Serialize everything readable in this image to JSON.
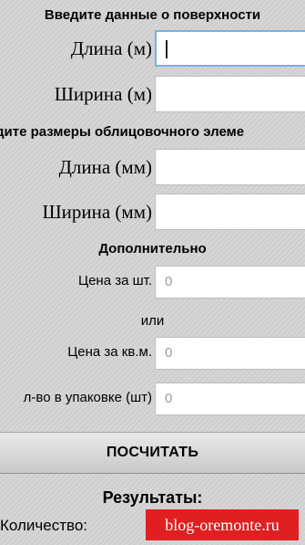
{
  "surface": {
    "heading": "Введите данные о поверхности",
    "length_label": "Длина (м)",
    "width_label": "Ширина (м)"
  },
  "tile": {
    "heading": "дите размеры облицовочного элеме",
    "length_label": "Длина (мм)",
    "width_label": "Ширина (мм)"
  },
  "extra": {
    "heading": "Дополнительно",
    "price_per_piece_label": "Цена за шт.",
    "price_per_piece_placeholder": "0",
    "or_text": "или",
    "price_per_sqm_label": "Цена за кв.м.",
    "price_per_sqm_placeholder": "0",
    "pack_count_label": "л-во в упаковке (шт)",
    "pack_count_placeholder": "0"
  },
  "calculate_button": "ПОСЧИТАТЬ",
  "results": {
    "heading": "Результаты:",
    "quantity_label": "Количество:"
  },
  "watermark": "blog-oremonte.ru"
}
